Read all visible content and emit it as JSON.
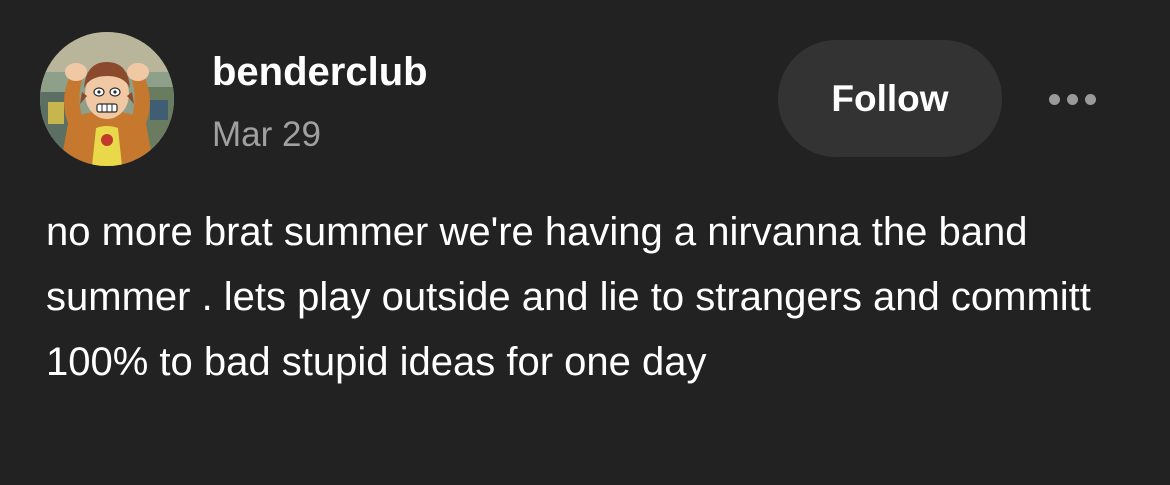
{
  "post": {
    "author": {
      "username": "benderclub",
      "avatar_icon": "cartoon-character-avatar"
    },
    "date": "Mar 29",
    "follow_label": "Follow",
    "more_icon": "more-horizontal-icon",
    "body": "no more brat summer we're having a nirvanna the band summer . lets play outside and lie to strangers and committ 100% to bad stupid ideas for one day"
  },
  "colors": {
    "background": "#222222",
    "text": "#ffffff",
    "secondary_text": "#a0a0a0",
    "button_bg": "#333333"
  }
}
